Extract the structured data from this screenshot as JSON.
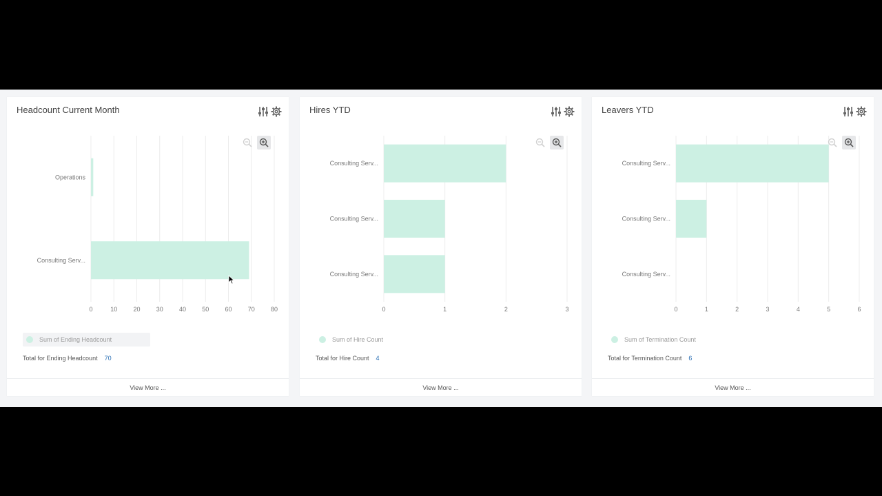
{
  "colors": {
    "bar": "#ccf0e3",
    "grid": "#ececec",
    "tick_text": "#777",
    "total_value": "#2a6fb5"
  },
  "icons": {
    "settings": "sliders-icon",
    "gear": "gear-icon",
    "zoom_out": "zoom-out-icon",
    "zoom_in": "zoom-in-icon"
  },
  "cards": [
    {
      "title": "Headcount Current Month",
      "legend_label": "Sum of Ending Headcount",
      "total_label": "Total for Ending Headcount",
      "total_value": "70",
      "view_more": "View More ..."
    },
    {
      "title": "Hires YTD",
      "legend_label": "Sum of Hire Count",
      "total_label": "Total for Hire Count",
      "total_value": "4",
      "view_more": "View More ..."
    },
    {
      "title": "Leavers YTD",
      "legend_label": "Sum of Termination Count",
      "total_label": "Total for Termination Count",
      "total_value": "6",
      "view_more": "View More ..."
    }
  ],
  "chart_data": [
    {
      "type": "bar",
      "orientation": "horizontal",
      "title": "Headcount Current Month",
      "categories": [
        "Operations",
        "Consulting Serv..."
      ],
      "values": [
        1,
        69
      ],
      "xlim": [
        0,
        80
      ],
      "xticks": [
        "0",
        "10",
        "20",
        "30",
        "40",
        "50",
        "60",
        "70",
        "80"
      ],
      "legend": [
        "Sum of Ending Headcount"
      ],
      "grid": true
    },
    {
      "type": "bar",
      "orientation": "horizontal",
      "title": "Hires YTD",
      "categories": [
        "Consulting Serv...",
        "Consulting Serv...",
        "Consulting Serv..."
      ],
      "values": [
        2,
        1,
        1
      ],
      "xlim": [
        0,
        3
      ],
      "xticks": [
        "0",
        "1",
        "2",
        "3"
      ],
      "legend": [
        "Sum of Hire Count"
      ],
      "grid": true
    },
    {
      "type": "bar",
      "orientation": "horizontal",
      "title": "Leavers YTD",
      "categories": [
        "Consulting Serv...",
        "Consulting Serv...",
        "Consulting Serv..."
      ],
      "values": [
        5,
        1,
        0
      ],
      "xlim": [
        0,
        6
      ],
      "xticks": [
        "0",
        "1",
        "2",
        "3",
        "4",
        "5",
        "6"
      ],
      "legend": [
        "Sum of Termination Count"
      ],
      "grid": true
    }
  ]
}
